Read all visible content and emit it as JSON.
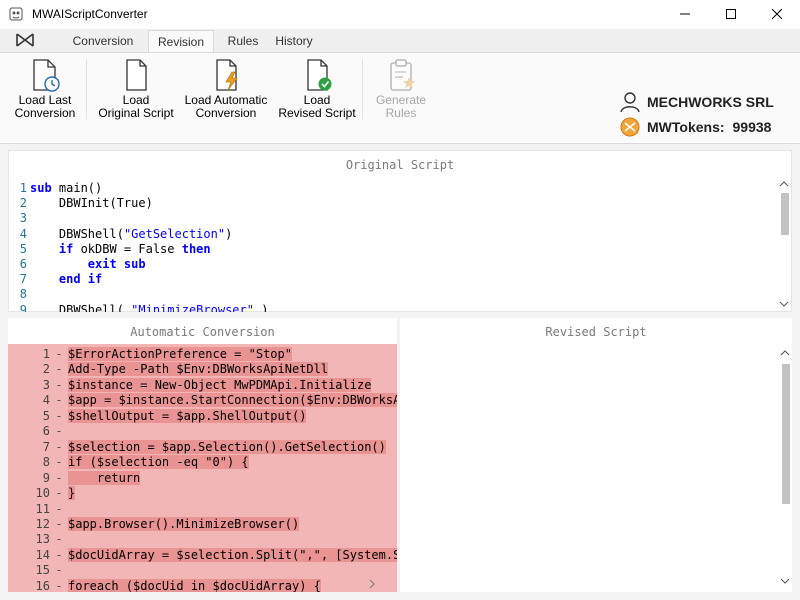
{
  "window": {
    "title": "MWAIScriptConverter"
  },
  "tabs": [
    {
      "label": "Conversion",
      "active": false
    },
    {
      "label": "Revision",
      "active": true
    },
    {
      "label": "Rules",
      "active": false
    },
    {
      "label": "History",
      "active": false
    }
  ],
  "ribbon": {
    "load_last": {
      "line1": "Load Last",
      "line2": "Conversion"
    },
    "load_original": {
      "line1": "Load",
      "line2": "Original Script"
    },
    "load_automatic": {
      "line1": "Load Automatic",
      "line2": "Conversion"
    },
    "load_revised": {
      "line1": "Load",
      "line2": "Revised Script"
    },
    "generate_rules": {
      "line1": "Generate",
      "line2": "Rules",
      "disabled": true
    }
  },
  "account": {
    "company": "MECHWORKS SRL",
    "tokens_label": "MWTokens:",
    "tokens_value": "99938"
  },
  "original": {
    "header": "Original Script",
    "lines": [
      {
        "n": "1",
        "indent": "",
        "kw1": "sub",
        "text": " main()",
        "str": "",
        "after": "",
        "kw2": ""
      },
      {
        "n": "2",
        "indent": "    ",
        "kw1": "",
        "text": "DBWInit(True)",
        "str": "",
        "after": "",
        "kw2": ""
      },
      {
        "n": "3",
        "indent": "",
        "kw1": "",
        "text": "",
        "str": "",
        "after": "",
        "kw2": ""
      },
      {
        "n": "4",
        "indent": "    ",
        "kw1": "",
        "text": "DBWShell(",
        "str": "\"GetSelection\"",
        "after": ")",
        "kw2": ""
      },
      {
        "n": "5",
        "indent": "    ",
        "kw1": "if",
        "text": " okDBW = False ",
        "str": "",
        "after": "",
        "kw2": "then"
      },
      {
        "n": "6",
        "indent": "        ",
        "kw1": "exit sub",
        "text": "",
        "str": "",
        "after": "",
        "kw2": ""
      },
      {
        "n": "7",
        "indent": "    ",
        "kw1": "end if",
        "text": "",
        "str": "",
        "after": "",
        "kw2": ""
      },
      {
        "n": "8",
        "indent": "",
        "kw1": "",
        "text": "",
        "str": "",
        "after": "",
        "kw2": ""
      },
      {
        "n": "9",
        "indent": "    ",
        "kw1": "",
        "text": "DBWShell( ",
        "str": "\"MinimizeBrowser\"",
        "after": " )",
        "kw2": ""
      }
    ]
  },
  "automatic": {
    "header": "Automatic Conversion",
    "lines": [
      {
        "n": "1",
        "text": "$ErrorActionPreference = \"Stop\""
      },
      {
        "n": "2",
        "text": "Add-Type -Path $Env:DBWorksApiNetDll"
      },
      {
        "n": "3",
        "text": "$instance = New-Object MwPDMApi.Initialize"
      },
      {
        "n": "4",
        "text": "$app = $instance.StartConnection($Env:DBWorksApi"
      },
      {
        "n": "5",
        "text": "$shellOutput = $app.ShellOutput()"
      },
      {
        "n": "6",
        "text": ""
      },
      {
        "n": "7",
        "text": "$selection = $app.Selection().GetSelection()"
      },
      {
        "n": "8",
        "text": "if ($selection -eq \"0\") {"
      },
      {
        "n": "9",
        "text": "    return"
      },
      {
        "n": "10",
        "text": "}"
      },
      {
        "n": "11",
        "text": ""
      },
      {
        "n": "12",
        "text": "$app.Browser().MinimizeBrowser()"
      },
      {
        "n": "13",
        "text": ""
      },
      {
        "n": "14",
        "text": "$docUidArray = $selection.Split(\",\", [System.St"
      },
      {
        "n": "15",
        "text": ""
      },
      {
        "n": "16",
        "text": "foreach ($docUid in $docUidArray) {"
      }
    ]
  },
  "revised": {
    "header": "Revised Script"
  }
}
